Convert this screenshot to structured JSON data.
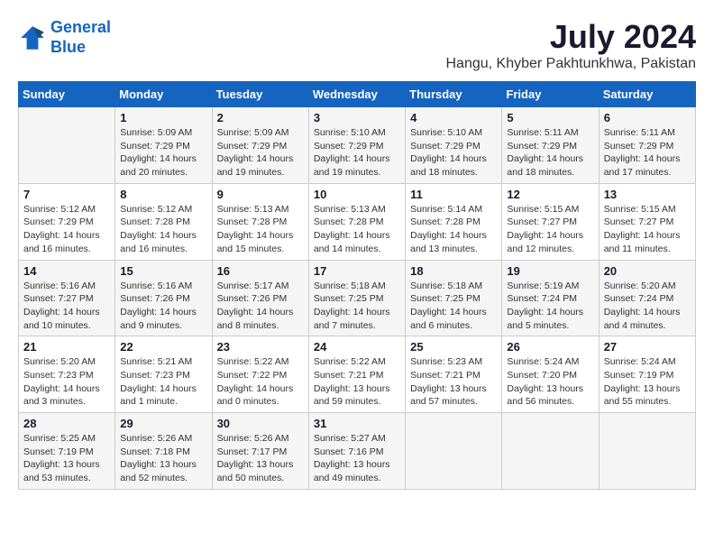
{
  "logo": {
    "line1": "General",
    "line2": "Blue"
  },
  "title": "July 2024",
  "location": "Hangu, Khyber Pakhtunkhwa, Pakistan",
  "weekdays": [
    "Sunday",
    "Monday",
    "Tuesday",
    "Wednesday",
    "Thursday",
    "Friday",
    "Saturday"
  ],
  "weeks": [
    [
      {
        "day": "",
        "info": ""
      },
      {
        "day": "1",
        "info": "Sunrise: 5:09 AM\nSunset: 7:29 PM\nDaylight: 14 hours\nand 20 minutes."
      },
      {
        "day": "2",
        "info": "Sunrise: 5:09 AM\nSunset: 7:29 PM\nDaylight: 14 hours\nand 19 minutes."
      },
      {
        "day": "3",
        "info": "Sunrise: 5:10 AM\nSunset: 7:29 PM\nDaylight: 14 hours\nand 19 minutes."
      },
      {
        "day": "4",
        "info": "Sunrise: 5:10 AM\nSunset: 7:29 PM\nDaylight: 14 hours\nand 18 minutes."
      },
      {
        "day": "5",
        "info": "Sunrise: 5:11 AM\nSunset: 7:29 PM\nDaylight: 14 hours\nand 18 minutes."
      },
      {
        "day": "6",
        "info": "Sunrise: 5:11 AM\nSunset: 7:29 PM\nDaylight: 14 hours\nand 17 minutes."
      }
    ],
    [
      {
        "day": "7",
        "info": "Sunrise: 5:12 AM\nSunset: 7:29 PM\nDaylight: 14 hours\nand 16 minutes."
      },
      {
        "day": "8",
        "info": "Sunrise: 5:12 AM\nSunset: 7:28 PM\nDaylight: 14 hours\nand 16 minutes."
      },
      {
        "day": "9",
        "info": "Sunrise: 5:13 AM\nSunset: 7:28 PM\nDaylight: 14 hours\nand 15 minutes."
      },
      {
        "day": "10",
        "info": "Sunrise: 5:13 AM\nSunset: 7:28 PM\nDaylight: 14 hours\nand 14 minutes."
      },
      {
        "day": "11",
        "info": "Sunrise: 5:14 AM\nSunset: 7:28 PM\nDaylight: 14 hours\nand 13 minutes."
      },
      {
        "day": "12",
        "info": "Sunrise: 5:15 AM\nSunset: 7:27 PM\nDaylight: 14 hours\nand 12 minutes."
      },
      {
        "day": "13",
        "info": "Sunrise: 5:15 AM\nSunset: 7:27 PM\nDaylight: 14 hours\nand 11 minutes."
      }
    ],
    [
      {
        "day": "14",
        "info": "Sunrise: 5:16 AM\nSunset: 7:27 PM\nDaylight: 14 hours\nand 10 minutes."
      },
      {
        "day": "15",
        "info": "Sunrise: 5:16 AM\nSunset: 7:26 PM\nDaylight: 14 hours\nand 9 minutes."
      },
      {
        "day": "16",
        "info": "Sunrise: 5:17 AM\nSunset: 7:26 PM\nDaylight: 14 hours\nand 8 minutes."
      },
      {
        "day": "17",
        "info": "Sunrise: 5:18 AM\nSunset: 7:25 PM\nDaylight: 14 hours\nand 7 minutes."
      },
      {
        "day": "18",
        "info": "Sunrise: 5:18 AM\nSunset: 7:25 PM\nDaylight: 14 hours\nand 6 minutes."
      },
      {
        "day": "19",
        "info": "Sunrise: 5:19 AM\nSunset: 7:24 PM\nDaylight: 14 hours\nand 5 minutes."
      },
      {
        "day": "20",
        "info": "Sunrise: 5:20 AM\nSunset: 7:24 PM\nDaylight: 14 hours\nand 4 minutes."
      }
    ],
    [
      {
        "day": "21",
        "info": "Sunrise: 5:20 AM\nSunset: 7:23 PM\nDaylight: 14 hours\nand 3 minutes."
      },
      {
        "day": "22",
        "info": "Sunrise: 5:21 AM\nSunset: 7:23 PM\nDaylight: 14 hours\nand 1 minute."
      },
      {
        "day": "23",
        "info": "Sunrise: 5:22 AM\nSunset: 7:22 PM\nDaylight: 14 hours\nand 0 minutes."
      },
      {
        "day": "24",
        "info": "Sunrise: 5:22 AM\nSunset: 7:21 PM\nDaylight: 13 hours\nand 59 minutes."
      },
      {
        "day": "25",
        "info": "Sunrise: 5:23 AM\nSunset: 7:21 PM\nDaylight: 13 hours\nand 57 minutes."
      },
      {
        "day": "26",
        "info": "Sunrise: 5:24 AM\nSunset: 7:20 PM\nDaylight: 13 hours\nand 56 minutes."
      },
      {
        "day": "27",
        "info": "Sunrise: 5:24 AM\nSunset: 7:19 PM\nDaylight: 13 hours\nand 55 minutes."
      }
    ],
    [
      {
        "day": "28",
        "info": "Sunrise: 5:25 AM\nSunset: 7:19 PM\nDaylight: 13 hours\nand 53 minutes."
      },
      {
        "day": "29",
        "info": "Sunrise: 5:26 AM\nSunset: 7:18 PM\nDaylight: 13 hours\nand 52 minutes."
      },
      {
        "day": "30",
        "info": "Sunrise: 5:26 AM\nSunset: 7:17 PM\nDaylight: 13 hours\nand 50 minutes."
      },
      {
        "day": "31",
        "info": "Sunrise: 5:27 AM\nSunset: 7:16 PM\nDaylight: 13 hours\nand 49 minutes."
      },
      {
        "day": "",
        "info": ""
      },
      {
        "day": "",
        "info": ""
      },
      {
        "day": "",
        "info": ""
      }
    ]
  ]
}
